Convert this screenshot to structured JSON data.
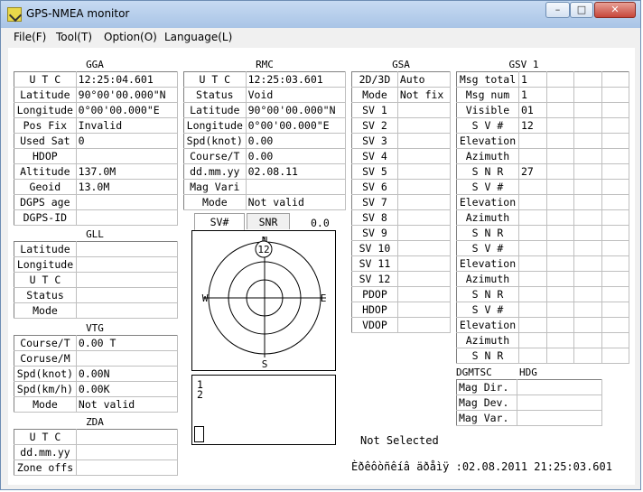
{
  "window": {
    "title": "GPS-NMEA monitor"
  },
  "menu": [
    "File(F)",
    "Tool(T)",
    "Option(O)",
    "Language(L)"
  ],
  "gga": {
    "title": "GGA",
    "rows": [
      {
        "label": "U T C",
        "value": "12:25:04.601"
      },
      {
        "label": "Latitude",
        "value": "90°00'00.000\"N"
      },
      {
        "label": "Longitude",
        "value": "0°00'00.000\"E"
      },
      {
        "label": "Pos Fix",
        "value": "Invalid"
      },
      {
        "label": "Used Sat",
        "value": "0"
      },
      {
        "label": "HDOP",
        "value": ""
      },
      {
        "label": "Altitude",
        "value": "137.0M"
      },
      {
        "label": "Geoid",
        "value": "13.0M"
      },
      {
        "label": "DGPS age",
        "value": ""
      },
      {
        "label": "DGPS-ID",
        "value": ""
      }
    ]
  },
  "gll": {
    "title": "GLL",
    "rows": [
      {
        "label": "Latitude",
        "value": ""
      },
      {
        "label": "Longitude",
        "value": ""
      },
      {
        "label": "U T C",
        "value": ""
      },
      {
        "label": "Status",
        "value": ""
      },
      {
        "label": "Mode",
        "value": ""
      }
    ]
  },
  "vtg": {
    "title": "VTG",
    "rows": [
      {
        "label": "Course/T",
        "value": "0.00 T"
      },
      {
        "label": "Coruse/M",
        "value": ""
      },
      {
        "label": "Spd(knot)",
        "value": "0.00N"
      },
      {
        "label": "Spd(km/h)",
        "value": "0.00K"
      },
      {
        "label": "Mode",
        "value": "Not valid"
      }
    ]
  },
  "zda": {
    "title": "ZDA",
    "rows": [
      {
        "label": "U T C",
        "value": ""
      },
      {
        "label": "dd.mm.yy",
        "value": ""
      },
      {
        "label": "Zone offs",
        "value": ""
      }
    ]
  },
  "rmc": {
    "title": "RMC",
    "rows": [
      {
        "label": "U T C",
        "value": "12:25:03.601"
      },
      {
        "label": "Status",
        "value": "Void"
      },
      {
        "label": "Latitude",
        "value": "90°00'00.000\"N"
      },
      {
        "label": "Longitude",
        "value": "0°00'00.000\"E"
      },
      {
        "label": "Spd(knot)",
        "value": "0.00"
      },
      {
        "label": "Course/T",
        "value": "0.00"
      },
      {
        "label": "dd.mm.yy",
        "value": "02.08.11"
      },
      {
        "label": "Mag Vari",
        "value": ""
      },
      {
        "label": "Mode",
        "value": "Not valid"
      }
    ]
  },
  "gsa": {
    "title": "GSA",
    "rows": [
      {
        "label": "2D/3D",
        "value": "Auto"
      },
      {
        "label": "Mode",
        "value": "Not fix"
      },
      {
        "label": "SV  1",
        "value": ""
      },
      {
        "label": "SV  2",
        "value": ""
      },
      {
        "label": "SV  3",
        "value": ""
      },
      {
        "label": "SV  4",
        "value": ""
      },
      {
        "label": "SV  5",
        "value": ""
      },
      {
        "label": "SV  6",
        "value": ""
      },
      {
        "label": "SV  7",
        "value": ""
      },
      {
        "label": "SV  8",
        "value": ""
      },
      {
        "label": "SV  9",
        "value": ""
      },
      {
        "label": "SV 10",
        "value": ""
      },
      {
        "label": "SV 11",
        "value": ""
      },
      {
        "label": "SV 12",
        "value": ""
      },
      {
        "label": "PDOP",
        "value": ""
      },
      {
        "label": "HDOP",
        "value": ""
      },
      {
        "label": "VDOP",
        "value": ""
      }
    ]
  },
  "gsv": {
    "title": "GSV 1",
    "header_rows": [
      {
        "label": "Msg total",
        "value": "1"
      },
      {
        "label": "Msg num",
        "value": "1"
      },
      {
        "label": "Visible",
        "value": "01"
      }
    ],
    "sats": [
      {
        "sv": "12",
        "elevation": "",
        "azimuth": "",
        "snr": "27"
      },
      {
        "sv": "",
        "elevation": "",
        "azimuth": "",
        "snr": ""
      },
      {
        "sv": "",
        "elevation": "",
        "azimuth": "",
        "snr": ""
      },
      {
        "sv": "",
        "elevation": "",
        "azimuth": "",
        "snr": ""
      }
    ],
    "sat_labels": {
      "sv": "S V #",
      "elevation": "Elevation",
      "azimuth": "Azimuth",
      "snr": "S N R"
    }
  },
  "dgmtsc": {
    "title": "DGMTSC",
    "title2": "HDG",
    "rows": [
      {
        "label": "Mag Dir.",
        "value": ""
      },
      {
        "label": "Mag Dev.",
        "value": ""
      },
      {
        "label": "Mag Var.",
        "value": ""
      }
    ]
  },
  "sky": {
    "tabs": [
      "SV#",
      "SNR"
    ],
    "active_tab": "SV#",
    "value": "0.0",
    "directions": {
      "n": "N",
      "e": "E",
      "s": "S",
      "w": "W"
    },
    "satellite_label": "12"
  },
  "sat_list": [
    "1",
    "2"
  ],
  "status": {
    "selection": "Not Selected",
    "timestamp": "Èðêôòñêíâ äðåìÿ :02.08.2011 21:25:03.601"
  }
}
